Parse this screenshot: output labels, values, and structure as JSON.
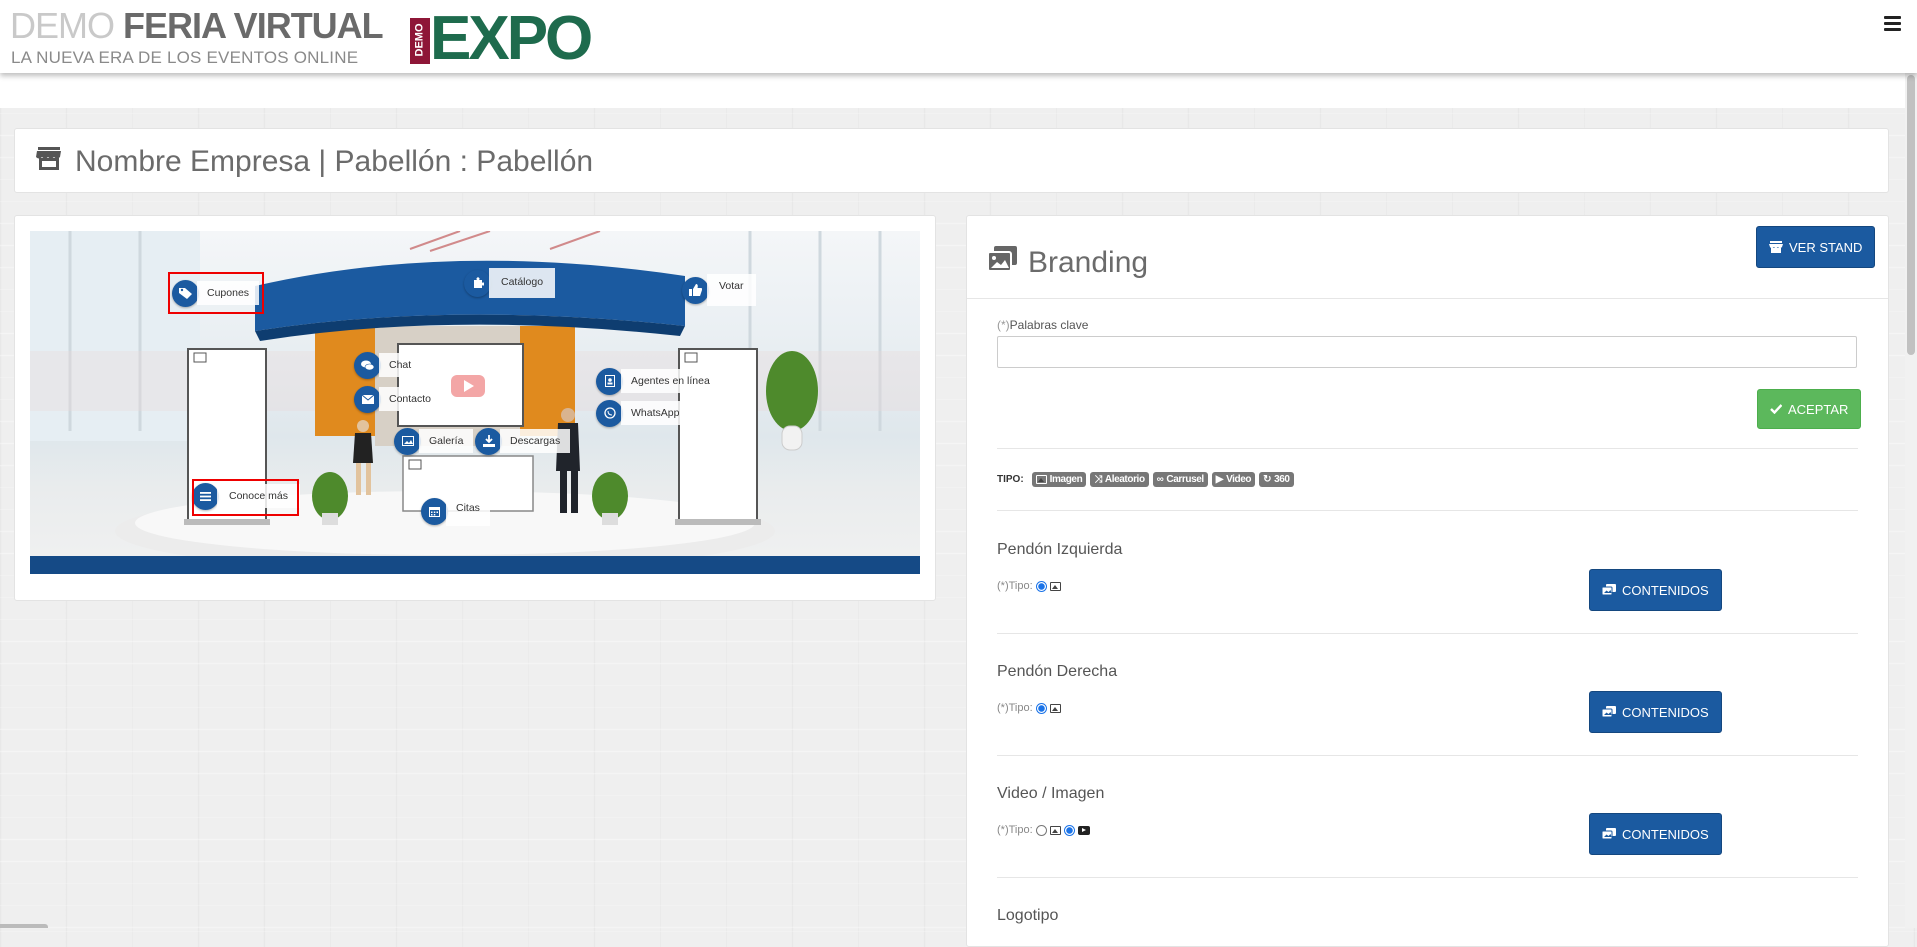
{
  "header": {
    "brand_demo": "DEMO ",
    "brand_name": "FERIA VIRTUAL",
    "tagline": "LA NUEVA ERA DE LOS EVENTOS ONLINE",
    "logo_tag": "DEMO",
    "logo_text": "EXPO",
    "menu_icon": "hamburger-icon"
  },
  "title_card": {
    "icon": "store-icon",
    "title": "Nombre Empresa | Pabellón : Pabellón"
  },
  "stand": {
    "hotspots": {
      "cupones": "Cupones",
      "catalogo": "Catálogo",
      "votar": "Votar",
      "chat": "Chat",
      "contacto": "Contacto",
      "agentes": "Agentes en línea",
      "whatsapp": "WhatsApp",
      "galeria": "Galería",
      "descargas": "Descargas",
      "conoce": "Conoce más",
      "citas": "Citas"
    },
    "accent_color": "#1b5aa0"
  },
  "branding": {
    "title": "Branding",
    "ver_stand": "VER STAND",
    "keywords_req": "(*)",
    "keywords_label": "Palabras clave",
    "keywords_value": "",
    "aceptar": "ACEPTAR",
    "tipo_label": "TIPO:",
    "tipos": {
      "imagen": "Imagen",
      "aleatorio": "Aleatorio",
      "carrusel": "Carrusel",
      "video": "Video",
      "t360": "360"
    },
    "tipo_prefix": "(*)Tipo:",
    "contenidos": "CONTENIDOS",
    "sections": {
      "izq": "Pendón Izquierda",
      "der": "Pendón Derecha",
      "video": "Video / Imagen",
      "logo": "Logotipo"
    }
  }
}
